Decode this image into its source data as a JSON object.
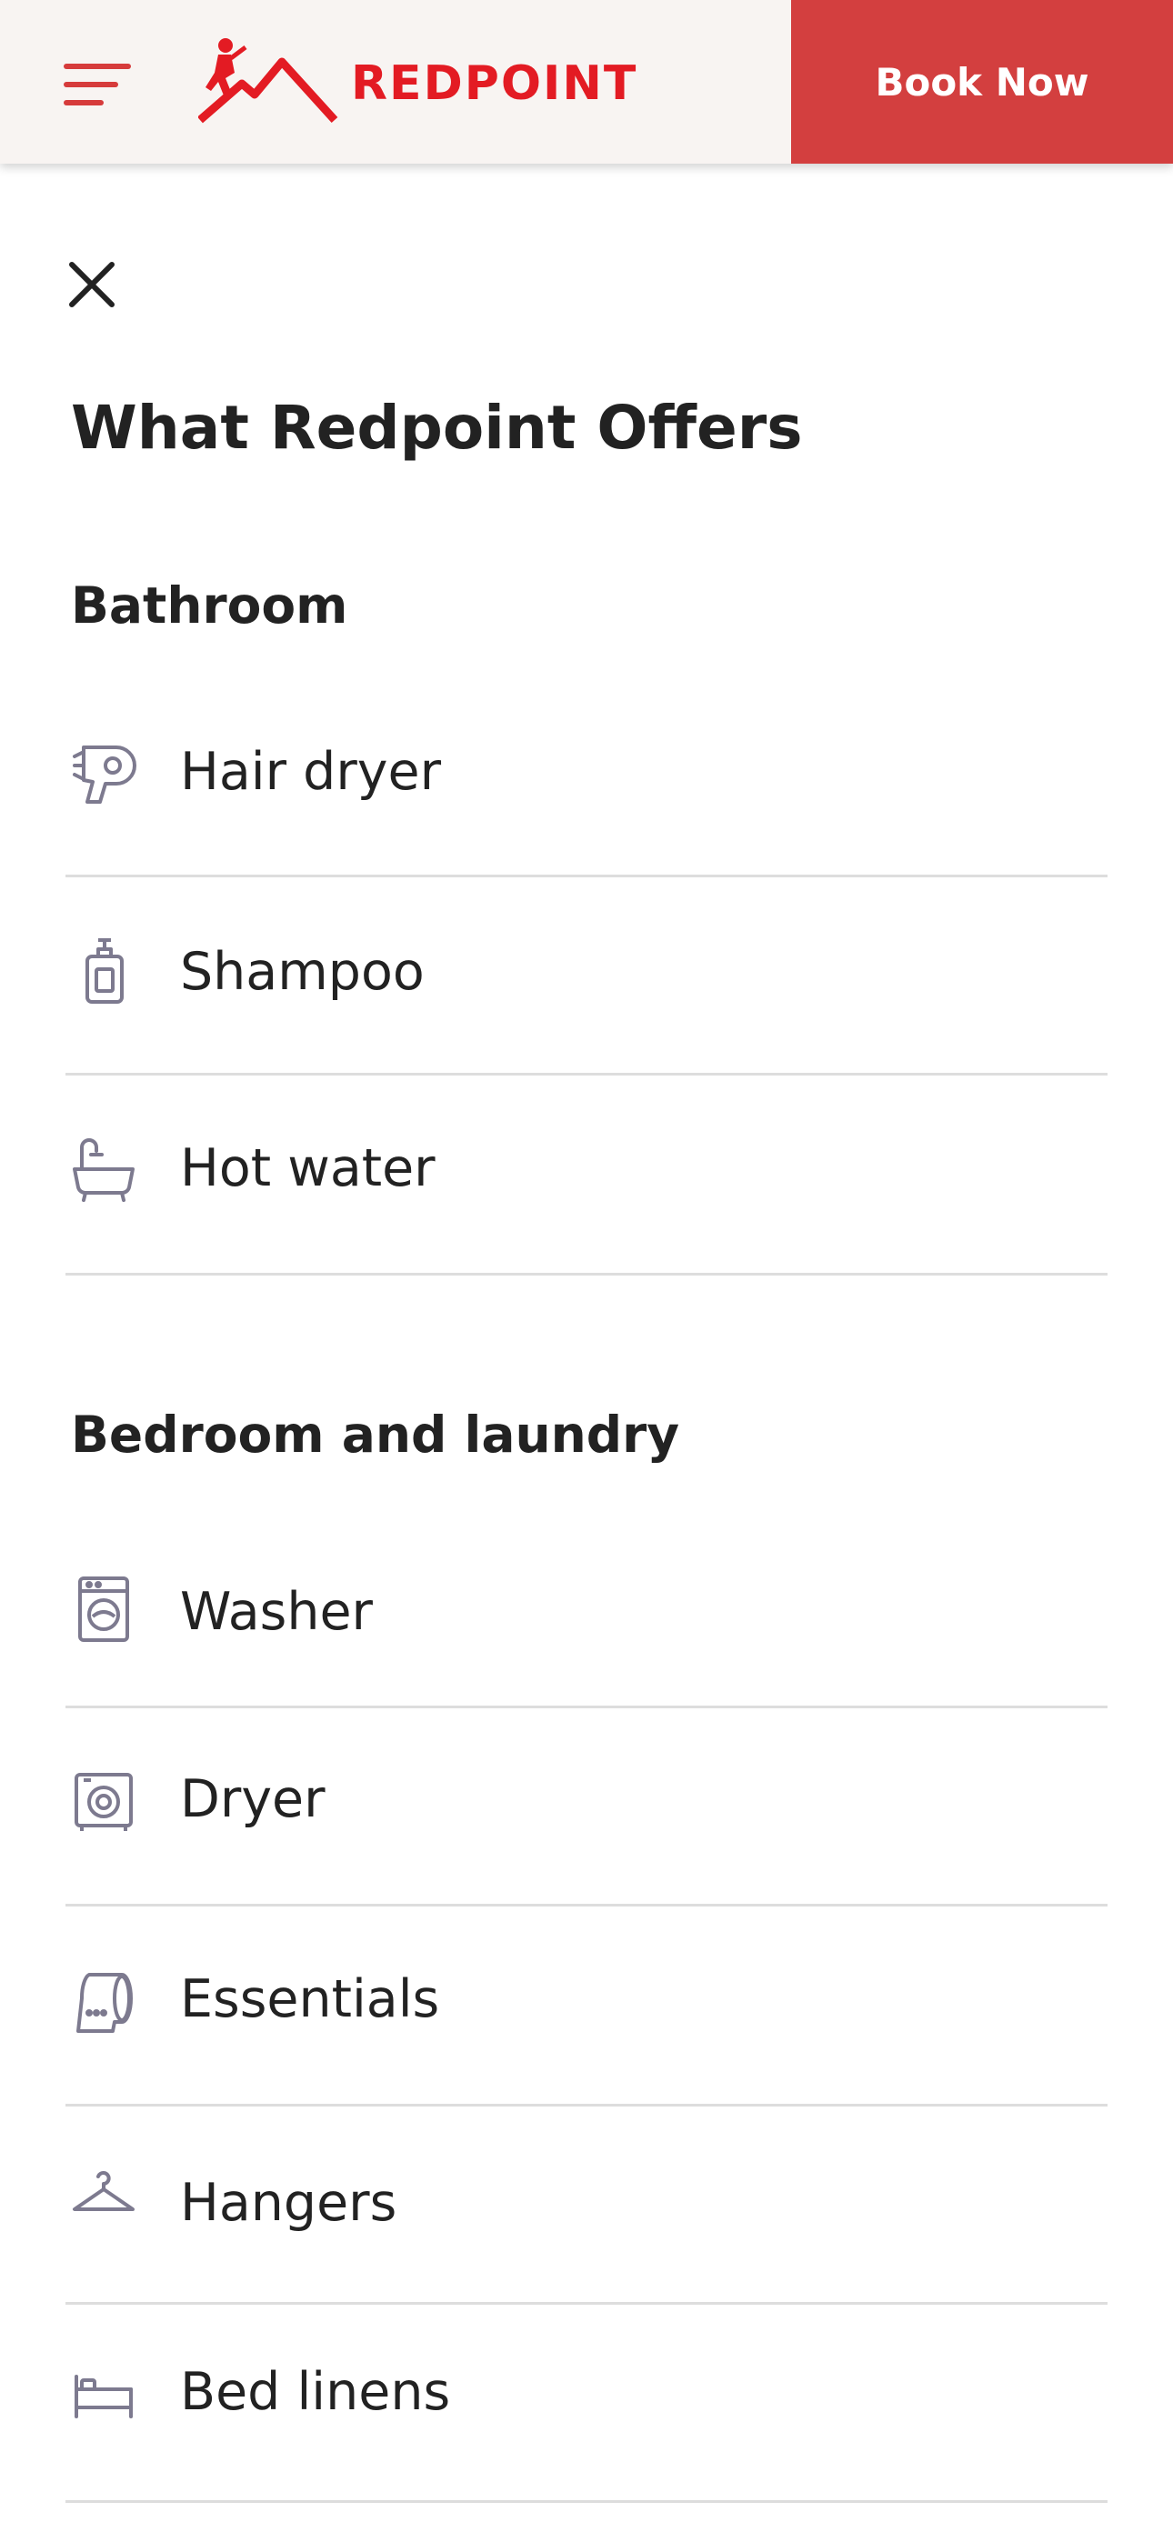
{
  "header": {
    "brand": "REDPOINT",
    "book_label": "Book Now",
    "menu_icon": "hamburger-menu-icon",
    "accent_color": "#d33f3f",
    "brand_color": "#e31b23"
  },
  "panel": {
    "close_icon": "close-icon",
    "title": "What Redpoint Offers"
  },
  "sections": [
    {
      "heading": "Bathroom",
      "items": [
        {
          "label": "Hair dryer",
          "icon": "hair-dryer-icon"
        },
        {
          "label": "Shampoo",
          "icon": "shampoo-bottle-icon"
        },
        {
          "label": "Hot water",
          "icon": "bathtub-icon"
        }
      ]
    },
    {
      "heading": "Bedroom and laundry",
      "items": [
        {
          "label": "Washer",
          "icon": "washing-machine-icon"
        },
        {
          "label": "Dryer",
          "icon": "dryer-icon"
        },
        {
          "label": "Essentials",
          "icon": "toilet-paper-icon"
        },
        {
          "label": "Hangers",
          "icon": "hanger-icon"
        },
        {
          "label": "Bed linens",
          "icon": "bed-icon"
        }
      ]
    }
  ]
}
